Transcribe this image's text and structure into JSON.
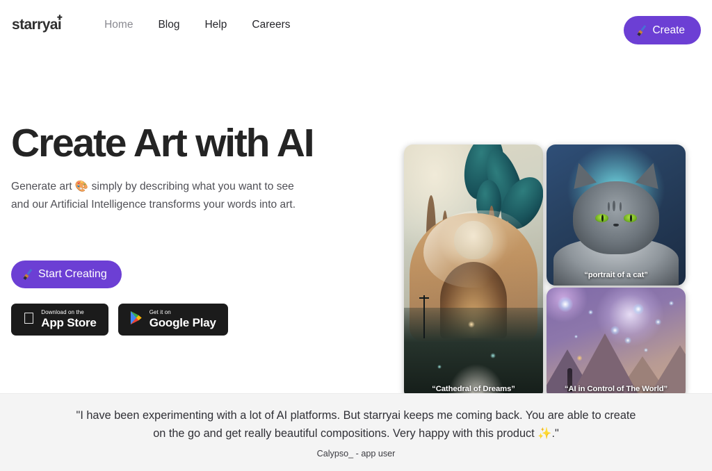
{
  "brand": {
    "name": "starryai",
    "spark_icon": "sparkle-icon"
  },
  "nav": {
    "links": [
      {
        "label": "Home",
        "active": true
      },
      {
        "label": "Blog",
        "active": false
      },
      {
        "label": "Help",
        "active": false
      },
      {
        "label": "Careers",
        "active": false
      }
    ],
    "create_button": {
      "label": "Create",
      "icon": "paintbrush-icon"
    }
  },
  "hero": {
    "headline": "Create Art with AI",
    "subhead_line1": "Generate art 🎨 simply by describing what you want to see",
    "subhead_line2": "and our Artificial Intelligence transforms your words into art.",
    "palette_emoji": "🎨",
    "primary_cta": {
      "label": "Start Creating",
      "icon": "paintbrush-icon"
    },
    "stores": [
      {
        "small": "Download on the",
        "big": "App Store",
        "icon": "apple-logo-icon"
      },
      {
        "small": "Get it on",
        "big": "Google Play",
        "icon": "google-play-icon"
      }
    ]
  },
  "gallery": {
    "items": [
      {
        "caption": "“Cathedral of Dreams”"
      },
      {
        "caption": "“portrait of a cat”"
      },
      {
        "caption": "“AI in Control of The World”"
      }
    ]
  },
  "testimonial": {
    "quote_line1": "\"I have been experimenting with a lot of AI platforms. But starryai keeps me coming back. You are able to create",
    "quote_line2_pre": "on the go and get really beautiful compositions. Very happy with this product ",
    "quote_sparkle": "✨",
    "quote_line2_post": ".\"",
    "author": "Calypso_ - app user"
  },
  "colors": {
    "accent_purple": "#6c3fd4",
    "page_bg": "#ffffff",
    "band_bg": "#f4f4f4",
    "heading": "#242424",
    "body_text": "#4f4f55",
    "badge_bg": "#1b1b1b"
  }
}
